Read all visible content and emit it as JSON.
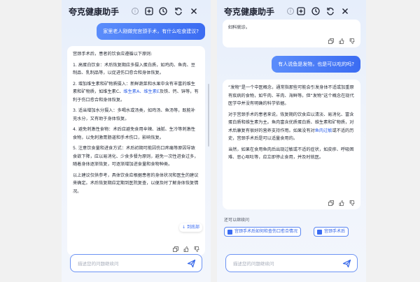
{
  "app": {
    "title": "夸克健康助手",
    "info_icon": "info-icon",
    "header_icons": [
      "add-square-icon",
      "history-clock-icon",
      "refresh-icon",
      "close-icon"
    ],
    "input_placeholder": "描述您的问题继续问"
  },
  "left": {
    "user_message": "家里老人刚做完宫颈手术，有什么吃食建议?",
    "ai": {
      "intro": "宫颈手术后，患者的饮食应遵循以下原则:",
      "p1": "1. 高蛋白饮食：术后恢复期应多摄入蛋白质，如鸡肉、鱼肉、豆制品、乳制品等，以促进伤口愈合和身体恢复。",
      "p2_pre": "2. 增加维生素和矿物质摄入：新鲜蔬菜和水果中含有丰富的维生素和矿物质，如维生素C、",
      "p2_link1": "维生素A",
      "p2_mid": "、维生素E",
      "p2_post": "及铁、钙、锌等，有利于伤口愈合和身体恢复。",
      "p3": "3. 适当增加水分摄入：多喝水或汤类，如鸡汤、鱼汤等，既能补充水分，又有助于身体恢复。",
      "p4": "4. 避免刺激性食物：术后应避免食用辛辣、油腻、生冷等刺激性食物，以免刺激胃肠道和手术伤口，影响恢复。",
      "p5": "5. 注意饮食量和进食方式：术后初期可能因伤口疼痛等原因导致食欲下降，应以易消化、少食多餐为原则，避免一次性进食过多，随着身体逐渐恢复，可逐渐增加进食量和食物种类。",
      "p6": "以上建议仅供参考，具体饮食应根据患者的身体状况和医生的建议来确定。术后恢复期应定期到医院复查，以便及时了解身体恢复情况。",
      "scroll_bottom": "到底部"
    }
  },
  "right": {
    "top_text": "妇科就诊。",
    "user_message": "有人说鱼是发物，也是可以吃的吗?",
    "ai": {
      "p1": "“发物”是一个中医概念，通常指那些可能会引发身体不适或加重原有疾病的食物，如牛肉、羊肉、海鲜等。但“发物”这个概念在现代医学中并没有明确的科学依据。",
      "p2_pre": "对于宫颈手术的患者来说，恢复期的饮食应以清淡、易消化、富含蛋白质和维生素为主。鱼肉富含优质蛋白质、维生素和矿物质，对术后康复有很好的营养支持作用。如果没有对",
      "p2_link": "鱼肉过敏",
      "p2_post": "或不适的历史，宫颈手术后是可以适量食用的。",
      "p3": "当然，如果在食用鱼肉后出现过敏或不适的症状，如皮疹、呼吸困难、恶心呕吐等，应立即停止食用，并及时就医。"
    },
    "suggest_label": "还可以继续问",
    "suggestions": [
      "宫颈手术后如何检查伤口愈合情况",
      "宫颈手术后"
    ]
  }
}
